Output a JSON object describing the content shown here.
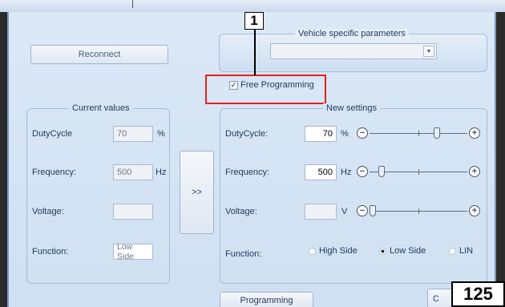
{
  "callout": {
    "number": "1"
  },
  "page_number": "125",
  "buttons": {
    "reconnect": "Reconnect",
    "transfer": ">>",
    "programming": "Programming",
    "bottom_right": "C"
  },
  "vehicle": {
    "title": "Vehicle specific parameters",
    "dropdown_value": ""
  },
  "free_programming": {
    "label": "Free Programming",
    "checked": true
  },
  "current_values": {
    "title": "Current values",
    "duty_label": "DutyCycle",
    "duty_value": "70",
    "duty_unit": "%",
    "freq_label": "Frequency:",
    "freq_value": "500",
    "freq_unit": "Hz",
    "volt_label": "Voltage:",
    "volt_value": "",
    "func_label": "Function:",
    "func_value": "Low Side"
  },
  "new_settings": {
    "title": "New settings",
    "duty_label": "DutyCycle:",
    "duty_value": "70",
    "duty_unit": "%",
    "duty_level": 0.7,
    "freq_label": "Frequency:",
    "freq_value": "500",
    "freq_unit": "Hz",
    "freq_level": 0.1,
    "volt_label": "Voltage:",
    "volt_value": "",
    "volt_unit": "V",
    "volt_level": 0.0,
    "func_label": "Function:",
    "options": [
      "High Side",
      "Low Side",
      "LIN"
    ],
    "selected": "Low Side"
  },
  "colors": {
    "highlight": "#e8201a",
    "window": "#d6e5f4"
  }
}
